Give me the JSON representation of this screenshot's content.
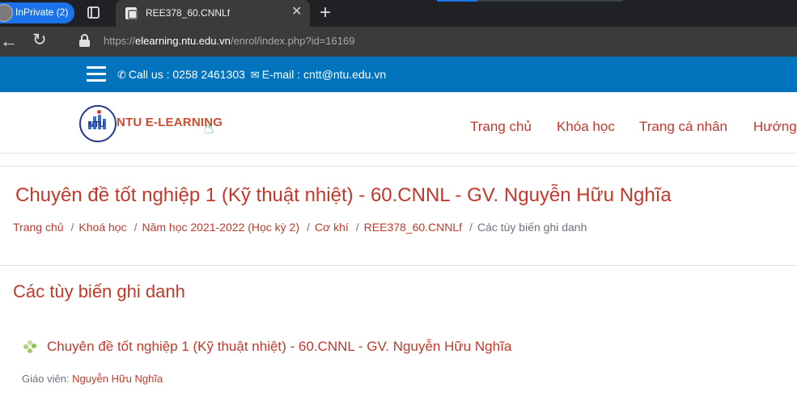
{
  "browser": {
    "inprivate_label": "InPrivate (2)",
    "tab_title": "REE378_60.CNNLf",
    "close_glyph": "✕",
    "newtab_glyph": "+",
    "back_glyph": "←",
    "reload_glyph": "↻",
    "url_scheme": "https://",
    "url_host": "elearning.ntu.edu.vn",
    "url_path": "/enrol/index.php?id=16169"
  },
  "sitebar": {
    "phone_icon": "phone-icon",
    "call_text": "Call us : 0258 2461303",
    "email_icon": "envelope-icon",
    "email_text": "E-mail : cntt@ntu.edu.vn",
    "bar_color": "#0274be"
  },
  "header": {
    "logo_mark": "NTU",
    "logo_text": "NTU E-LEARNING",
    "nav": [
      {
        "label": "Trang chủ"
      },
      {
        "label": "Khóa học"
      },
      {
        "label": "Trang cá nhân"
      },
      {
        "label": "Hướng"
      }
    ]
  },
  "page": {
    "course_title": "Chuyên đề tốt nghiệp 1 (Kỹ thuật nhiệt) - 60.CNNL - GV. Nguyễn Hữu Nghĩa",
    "breadcrumb": [
      {
        "label": "Trang chủ"
      },
      {
        "label": "Khoá học"
      },
      {
        "label": "Năm học 2021-2022 (Học kỳ 2)"
      },
      {
        "label": "Cơ khí"
      },
      {
        "label": "REE378_60.CNNLf"
      },
      {
        "label": "Các tùy biến ghi danh"
      }
    ],
    "breadcrumb_sep": "/",
    "section_title": "Các tùy biến ghi danh",
    "course_link": "Chuyên đề tốt nghiệp 1 (Kỹ thuật nhiệt) - 60.CNNL - GV. Nguyễn Hữu Nghĩa",
    "teacher_label": "Giáo viên: ",
    "teacher_name": "Nguyễn Hữu Nghĩa",
    "accent_color": "#c0392b"
  }
}
